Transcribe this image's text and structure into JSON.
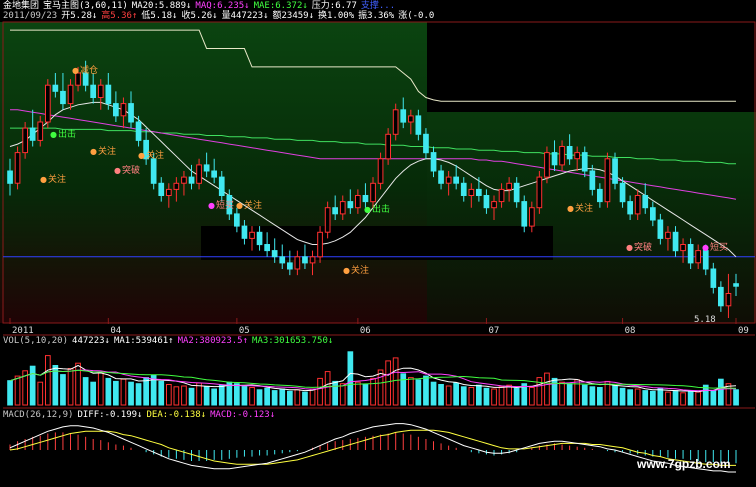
{
  "header": {
    "line1": [
      {
        "text": "金地集团",
        "color": "#ffffff"
      },
      {
        "text": "宝马主图(3,60,11)",
        "color": "#ffffff"
      },
      {
        "text": "MA20:5.889↓",
        "color": "#ffffff"
      },
      {
        "text": "MAQ:6.235↓",
        "color": "#ff40ff"
      },
      {
        "text": "MAE:6.372↓",
        "color": "#40ff40"
      },
      {
        "text": "压力:6.77",
        "color": "#ffffff"
      },
      {
        "text": "支撑...",
        "color": "#4060ff"
      }
    ],
    "line2": [
      {
        "text": "2011/09/23",
        "color": "#c8c8c8"
      },
      {
        "text": "开5.28↓",
        "color": "#ffffff"
      },
      {
        "text": "高5.36↑",
        "color": "#ff4040"
      },
      {
        "text": "低5.18↓",
        "color": "#ffffff"
      },
      {
        "text": "收5.26↓",
        "color": "#ffffff"
      },
      {
        "text": "量447223↓",
        "color": "#ffffff"
      },
      {
        "text": "额23459↓",
        "color": "#ffffff"
      },
      {
        "text": "换1.00%",
        "color": "#ffffff"
      },
      {
        "text": "振3.36%",
        "color": "#ffffff"
      },
      {
        "text": "涨(-0.0",
        "color": "#ffffff"
      }
    ]
  },
  "vol_header": [
    {
      "text": "VOL(5,10,20)",
      "color": "#c8c8c8"
    },
    {
      "text": "447223↓",
      "color": "#ffffff"
    },
    {
      "text": "MA1:539461↑",
      "color": "#ffffff"
    },
    {
      "text": "MA2:380923.5↑",
      "color": "#ff40ff"
    },
    {
      "text": "MA3:301653.750↓",
      "color": "#40ff40"
    }
  ],
  "macd_header": [
    {
      "text": "MACD(26,12,9)",
      "color": "#c8c8c8"
    },
    {
      "text": "DIFF:-0.199↓",
      "color": "#ffffff"
    },
    {
      "text": "DEA:-0.138↓",
      "color": "#ffff40"
    },
    {
      "text": "MACD:-0.123↓",
      "color": "#ff40ff"
    }
  ],
  "signals": [
    {
      "text": "减仓",
      "dot": "#ffa040",
      "color": "#ffa040"
    },
    {
      "text": "出击",
      "dot": "#40ff40",
      "color": "#40ff40"
    },
    {
      "text": "关注",
      "dot": "#ffa040",
      "color": "#ffa040"
    },
    {
      "text": "关注",
      "dot": "#ffa040",
      "color": "#ffa040"
    },
    {
      "text": "关注",
      "dot": "#ffa040",
      "color": "#ffa040"
    },
    {
      "text": "突破",
      "dot": "#ff8080",
      "color": "#ff8080"
    },
    {
      "text": "短买",
      "dot": "#ff40ff",
      "color": "#ff8080"
    },
    {
      "text": "关注",
      "dot": "#ffa040",
      "color": "#ffa040"
    },
    {
      "text": "出击",
      "dot": "#40ff40",
      "color": "#40ff40"
    },
    {
      "text": "关注",
      "dot": "#ffa040",
      "color": "#ffa040"
    },
    {
      "text": "关注",
      "dot": "#ffa040",
      "color": "#ffa040"
    },
    {
      "text": "突破",
      "dot": "#ff8080",
      "color": "#ff8080"
    },
    {
      "text": "短买",
      "dot": "#ff40ff",
      "color": "#ff8080"
    }
  ],
  "last_price_label": "5.18",
  "watermark": "www.7gpzb.com",
  "chart_data": {
    "type": "candlestick",
    "x_ticks": [
      "2011",
      "04",
      "05",
      "06",
      "07",
      "08",
      "09"
    ],
    "price_ylim": [
      5.0,
      7.4
    ],
    "candles": [
      [
        6.2,
        6.3,
        6.0,
        6.1
      ],
      [
        6.1,
        6.4,
        6.05,
        6.35
      ],
      [
        6.35,
        6.6,
        6.3,
        6.55
      ],
      [
        6.55,
        6.7,
        6.4,
        6.45
      ],
      [
        6.45,
        6.65,
        6.4,
        6.6
      ],
      [
        6.6,
        6.95,
        6.55,
        6.9
      ],
      [
        6.9,
        7.0,
        6.8,
        6.85
      ],
      [
        6.85,
        7.0,
        6.7,
        6.75
      ],
      [
        6.75,
        6.95,
        6.7,
        6.9
      ],
      [
        6.9,
        7.05,
        6.85,
        7.0
      ],
      [
        7.0,
        7.1,
        6.85,
        6.9
      ],
      [
        6.9,
        7.0,
        6.75,
        6.8
      ],
      [
        6.8,
        6.95,
        6.7,
        6.9
      ],
      [
        6.9,
        7.0,
        6.7,
        6.75
      ],
      [
        6.75,
        6.85,
        6.6,
        6.65
      ],
      [
        6.65,
        6.8,
        6.55,
        6.75
      ],
      [
        6.75,
        6.85,
        6.55,
        6.6
      ],
      [
        6.6,
        6.65,
        6.4,
        6.45
      ],
      [
        6.45,
        6.55,
        6.25,
        6.3
      ],
      [
        6.3,
        6.35,
        6.05,
        6.1
      ],
      [
        6.1,
        6.15,
        5.95,
        6.0
      ],
      [
        6.0,
        6.1,
        5.9,
        6.05
      ],
      [
        6.05,
        6.15,
        5.95,
        6.1
      ],
      [
        6.1,
        6.2,
        6.0,
        6.15
      ],
      [
        6.15,
        6.25,
        6.05,
        6.1
      ],
      [
        6.1,
        6.3,
        6.05,
        6.25
      ],
      [
        6.25,
        6.35,
        6.15,
        6.2
      ],
      [
        6.2,
        6.3,
        6.1,
        6.15
      ],
      [
        6.15,
        6.2,
        5.95,
        6.0
      ],
      [
        6.0,
        6.05,
        5.8,
        5.85
      ],
      [
        5.85,
        5.9,
        5.7,
        5.75
      ],
      [
        5.75,
        5.8,
        5.6,
        5.65
      ],
      [
        5.65,
        5.75,
        5.55,
        5.7
      ],
      [
        5.7,
        5.75,
        5.55,
        5.6
      ],
      [
        5.6,
        5.7,
        5.5,
        5.55
      ],
      [
        5.55,
        5.65,
        5.45,
        5.5
      ],
      [
        5.5,
        5.6,
        5.4,
        5.45
      ],
      [
        5.45,
        5.55,
        5.35,
        5.4
      ],
      [
        5.4,
        5.55,
        5.35,
        5.5
      ],
      [
        5.5,
        5.6,
        5.4,
        5.45
      ],
      [
        5.45,
        5.55,
        5.35,
        5.5
      ],
      [
        5.5,
        5.75,
        5.45,
        5.7
      ],
      [
        5.7,
        5.95,
        5.65,
        5.9
      ],
      [
        5.9,
        6.0,
        5.8,
        5.85
      ],
      [
        5.85,
        6.0,
        5.8,
        5.95
      ],
      [
        5.95,
        6.05,
        5.85,
        5.9
      ],
      [
        5.9,
        6.05,
        5.85,
        6.0
      ],
      [
        6.0,
        6.1,
        5.9,
        5.95
      ],
      [
        5.95,
        6.15,
        5.9,
        6.1
      ],
      [
        6.1,
        6.35,
        6.05,
        6.3
      ],
      [
        6.3,
        6.55,
        6.25,
        6.5
      ],
      [
        6.5,
        6.75,
        6.45,
        6.7
      ],
      [
        6.7,
        6.8,
        6.55,
        6.6
      ],
      [
        6.6,
        6.7,
        6.5,
        6.65
      ],
      [
        6.65,
        6.7,
        6.45,
        6.5
      ],
      [
        6.5,
        6.55,
        6.3,
        6.35
      ],
      [
        6.35,
        6.4,
        6.15,
        6.2
      ],
      [
        6.2,
        6.25,
        6.05,
        6.1
      ],
      [
        6.1,
        6.2,
        6.0,
        6.15
      ],
      [
        6.15,
        6.25,
        6.05,
        6.1
      ],
      [
        6.1,
        6.15,
        5.95,
        6.0
      ],
      [
        6.0,
        6.1,
        5.9,
        6.05
      ],
      [
        6.05,
        6.15,
        5.95,
        6.0
      ],
      [
        6.0,
        6.05,
        5.85,
        5.9
      ],
      [
        5.9,
        6.0,
        5.8,
        5.95
      ],
      [
        5.95,
        6.1,
        5.9,
        6.05
      ],
      [
        6.05,
        6.15,
        5.95,
        6.1
      ],
      [
        6.1,
        6.15,
        5.9,
        5.95
      ],
      [
        5.95,
        6.0,
        5.7,
        5.75
      ],
      [
        5.75,
        5.95,
        5.7,
        5.9
      ],
      [
        5.9,
        6.2,
        5.85,
        6.15
      ],
      [
        6.15,
        6.4,
        6.1,
        6.35
      ],
      [
        6.35,
        6.45,
        6.2,
        6.25
      ],
      [
        6.25,
        6.45,
        6.2,
        6.4
      ],
      [
        6.4,
        6.5,
        6.25,
        6.3
      ],
      [
        6.3,
        6.4,
        6.2,
        6.35
      ],
      [
        6.35,
        6.4,
        6.15,
        6.2
      ],
      [
        6.2,
        6.25,
        6.0,
        6.05
      ],
      [
        6.05,
        6.1,
        5.9,
        5.95
      ],
      [
        5.95,
        6.35,
        5.9,
        6.3
      ],
      [
        6.3,
        6.35,
        6.05,
        6.1
      ],
      [
        6.1,
        6.15,
        5.9,
        5.95
      ],
      [
        5.95,
        6.0,
        5.8,
        5.85
      ],
      [
        5.85,
        6.05,
        5.8,
        6.0
      ],
      [
        6.0,
        6.1,
        5.85,
        5.9
      ],
      [
        5.9,
        5.95,
        5.75,
        5.8
      ],
      [
        5.8,
        5.85,
        5.6,
        5.65
      ],
      [
        5.65,
        5.75,
        5.55,
        5.7
      ],
      [
        5.7,
        5.75,
        5.5,
        5.55
      ],
      [
        5.55,
        5.65,
        5.45,
        5.6
      ],
      [
        5.6,
        5.65,
        5.4,
        5.45
      ],
      [
        5.45,
        5.6,
        5.4,
        5.55
      ],
      [
        5.55,
        5.6,
        5.35,
        5.4
      ],
      [
        5.4,
        5.45,
        5.2,
        5.25
      ],
      [
        5.25,
        5.3,
        5.05,
        5.1
      ],
      [
        5.1,
        5.36,
        5.0,
        5.2
      ],
      [
        5.28,
        5.36,
        5.18,
        5.26
      ]
    ],
    "ma20": [
      6.4,
      6.42,
      6.45,
      6.5,
      6.55,
      6.6,
      6.66,
      6.7,
      6.72,
      6.74,
      6.75,
      6.76,
      6.76,
      6.74,
      6.72,
      6.7,
      6.66,
      6.62,
      6.56,
      6.5,
      6.44,
      6.38,
      6.32,
      6.26,
      6.2,
      6.16,
      6.12,
      6.08,
      6.04,
      6.0,
      5.96,
      5.92,
      5.88,
      5.84,
      5.8,
      5.76,
      5.72,
      5.68,
      5.64,
      5.62,
      5.6,
      5.6,
      5.61,
      5.63,
      5.66,
      5.7,
      5.76,
      5.82,
      5.9,
      5.98,
      6.06,
      6.14,
      6.2,
      6.25,
      6.28,
      6.3,
      6.3,
      6.29,
      6.27,
      6.24,
      6.2,
      6.16,
      6.12,
      6.08,
      6.05,
      6.04,
      6.04,
      6.06,
      6.08,
      6.1,
      6.12,
      6.14,
      6.16,
      6.18,
      6.2,
      6.21,
      6.22,
      6.22,
      6.21,
      6.19,
      6.16,
      6.12,
      6.08,
      6.04,
      6.0,
      5.96,
      5.92,
      5.88,
      5.84,
      5.8,
      5.76,
      5.72,
      5.68,
      5.64,
      5.6,
      5.56,
      5.5
    ],
    "ma60": [
      6.7,
      6.7,
      6.69,
      6.68,
      6.67,
      6.66,
      6.65,
      6.64,
      6.63,
      6.62,
      6.61,
      6.6,
      6.59,
      6.58,
      6.57,
      6.56,
      6.55,
      6.54,
      6.53,
      6.52,
      6.51,
      6.5,
      6.49,
      6.48,
      6.47,
      6.46,
      6.45,
      6.44,
      6.43,
      6.42,
      6.41,
      6.4,
      6.39,
      6.38,
      6.37,
      6.36,
      6.35,
      6.34,
      6.33,
      6.32,
      6.31,
      6.3,
      6.3,
      6.3,
      6.3,
      6.3,
      6.3,
      6.3,
      6.3,
      6.3,
      6.3,
      6.3,
      6.3,
      6.3,
      6.3,
      6.3,
      6.3,
      6.3,
      6.3,
      6.3,
      6.3,
      6.3,
      6.29,
      6.29,
      6.28,
      6.28,
      6.27,
      6.26,
      6.25,
      6.24,
      6.23,
      6.22,
      6.21,
      6.2,
      6.19,
      6.18,
      6.17,
      6.16,
      6.15,
      6.14,
      6.13,
      6.12,
      6.11,
      6.1,
      6.09,
      6.08,
      6.07,
      6.06,
      6.05,
      6.04,
      6.03,
      6.02,
      6.01,
      6.0,
      5.99,
      5.98,
      5.97
    ],
    "ma120": [
      6.55,
      6.55,
      6.55,
      6.55,
      6.55,
      6.55,
      6.55,
      6.54,
      6.54,
      6.54,
      6.54,
      6.54,
      6.54,
      6.53,
      6.53,
      6.53,
      6.53,
      6.52,
      6.52,
      6.52,
      6.51,
      6.51,
      6.51,
      6.5,
      6.5,
      6.5,
      6.49,
      6.49,
      6.49,
      6.48,
      6.48,
      6.48,
      6.47,
      6.47,
      6.47,
      6.46,
      6.46,
      6.46,
      6.45,
      6.45,
      6.45,
      6.44,
      6.44,
      6.44,
      6.43,
      6.43,
      6.43,
      6.42,
      6.42,
      6.42,
      6.41,
      6.41,
      6.41,
      6.4,
      6.4,
      6.4,
      6.39,
      6.39,
      6.39,
      6.38,
      6.38,
      6.38,
      6.37,
      6.37,
      6.37,
      6.36,
      6.36,
      6.36,
      6.35,
      6.35,
      6.35,
      6.34,
      6.34,
      6.34,
      6.33,
      6.33,
      6.33,
      6.32,
      6.32,
      6.32,
      6.31,
      6.31,
      6.31,
      6.3,
      6.3,
      6.3,
      6.29,
      6.29,
      6.29,
      6.28,
      6.28,
      6.28,
      6.27,
      6.27,
      6.27,
      6.26,
      6.26
    ],
    "pressure_line": [
      7.35,
      7.35,
      7.35,
      7.35,
      7.35,
      7.35,
      7.35,
      7.35,
      7.35,
      7.35,
      7.35,
      7.35,
      7.35,
      7.35,
      7.35,
      7.35,
      7.35,
      7.35,
      7.35,
      7.35,
      7.35,
      7.35,
      7.35,
      7.35,
      7.35,
      7.35,
      7.2,
      7.2,
      7.2,
      7.2,
      7.2,
      7.2,
      7.05,
      7.05,
      7.05,
      7.05,
      7.05,
      7.05,
      7.05,
      7.05,
      7.05,
      7.05,
      7.05,
      7.05,
      7.05,
      7.05,
      7.05,
      7.05,
      7.05,
      7.05,
      7.05,
      7.05,
      7.0,
      6.95,
      6.85,
      6.8,
      6.78,
      6.77,
      6.77,
      6.77,
      6.77,
      6.77,
      6.77,
      6.77,
      6.77,
      6.77,
      6.77,
      6.77,
      6.77,
      6.77,
      6.77,
      6.77,
      6.77,
      6.77,
      6.77,
      6.77,
      6.77,
      6.77,
      6.77,
      6.77,
      6.77,
      6.77,
      6.77,
      6.77,
      6.77,
      6.77,
      6.77,
      6.77,
      6.77,
      6.77,
      6.77,
      6.77,
      6.77,
      6.77,
      6.77,
      6.77,
      6.77
    ],
    "support_level": 5.5,
    "volume": [
      3.2,
      3.8,
      4.5,
      5.1,
      3.0,
      6.5,
      5.2,
      4.0,
      4.8,
      5.5,
      3.6,
      3.0,
      4.2,
      3.5,
      3.1,
      3.4,
      3.0,
      2.8,
      3.6,
      3.9,
      3.1,
      2.7,
      2.4,
      2.5,
      2.2,
      2.9,
      2.4,
      2.1,
      2.6,
      3.0,
      2.8,
      2.5,
      2.3,
      2.0,
      2.2,
      1.9,
      2.1,
      1.8,
      2.0,
      1.7,
      2.1,
      3.5,
      4.4,
      3.1,
      2.8,
      7.0,
      3.0,
      2.7,
      3.5,
      4.6,
      5.8,
      6.2,
      4.1,
      3.6,
      3.3,
      3.8,
      3.0,
      2.7,
      2.5,
      2.9,
      2.4,
      2.3,
      2.6,
      2.2,
      2.1,
      2.4,
      2.6,
      2.2,
      2.8,
      2.3,
      3.6,
      4.2,
      3.5,
      3.0,
      2.8,
      3.3,
      2.6,
      2.4,
      2.3,
      3.1,
      2.5,
      2.2,
      2.0,
      2.1,
      1.9,
      1.8,
      2.2,
      1.7,
      1.9,
      1.6,
      1.8,
      1.7,
      2.6,
      1.9,
      3.4,
      2.8,
      2.0
    ],
    "macd_hist": [
      0.05,
      0.08,
      0.1,
      0.12,
      0.13,
      0.15,
      0.16,
      0.16,
      0.15,
      0.14,
      0.12,
      0.1,
      0.09,
      0.07,
      0.05,
      0.04,
      0.02,
      0.0,
      -0.02,
      -0.04,
      -0.06,
      -0.07,
      -0.08,
      -0.09,
      -0.1,
      -0.1,
      -0.1,
      -0.09,
      -0.09,
      -0.08,
      -0.07,
      -0.06,
      -0.06,
      -0.05,
      -0.05,
      -0.04,
      -0.03,
      -0.02,
      -0.01,
      0.0,
      0.02,
      0.04,
      0.06,
      0.08,
      0.09,
      0.1,
      0.11,
      0.12,
      0.13,
      0.14,
      0.15,
      0.16,
      0.15,
      0.14,
      0.12,
      0.1,
      0.08,
      0.06,
      0.04,
      0.02,
      0.0,
      -0.02,
      -0.03,
      -0.04,
      -0.05,
      -0.04,
      -0.03,
      -0.02,
      0.0,
      0.02,
      0.04,
      0.05,
      0.06,
      0.05,
      0.04,
      0.03,
      0.02,
      0.01,
      0.0,
      -0.01,
      -0.02,
      -0.02,
      -0.03,
      -0.04,
      -0.05,
      -0.06,
      -0.06,
      -0.07,
      -0.08,
      -0.08,
      -0.09,
      -0.1,
      -0.11,
      -0.11,
      -0.12,
      -0.12,
      -0.12
    ],
    "diff": [
      0.02,
      0.05,
      0.08,
      0.11,
      0.14,
      0.17,
      0.19,
      0.21,
      0.22,
      0.22,
      0.21,
      0.2,
      0.18,
      0.16,
      0.13,
      0.1,
      0.07,
      0.04,
      0.01,
      -0.02,
      -0.05,
      -0.08,
      -0.1,
      -0.12,
      -0.14,
      -0.15,
      -0.16,
      -0.17,
      -0.17,
      -0.17,
      -0.16,
      -0.15,
      -0.14,
      -0.13,
      -0.12,
      -0.1,
      -0.08,
      -0.06,
      -0.04,
      -0.02,
      0.01,
      0.04,
      0.07,
      0.1,
      0.12,
      0.15,
      0.17,
      0.19,
      0.21,
      0.22,
      0.23,
      0.24,
      0.24,
      0.23,
      0.21,
      0.19,
      0.16,
      0.13,
      0.1,
      0.07,
      0.04,
      0.02,
      0.0,
      -0.02,
      -0.03,
      -0.03,
      -0.02,
      0.0,
      0.02,
      0.04,
      0.06,
      0.07,
      0.08,
      0.08,
      0.07,
      0.06,
      0.05,
      0.04,
      0.03,
      0.01,
      0.0,
      -0.02,
      -0.04,
      -0.06,
      -0.08,
      -0.1,
      -0.11,
      -0.12,
      -0.14,
      -0.15,
      -0.16,
      -0.17,
      -0.18,
      -0.19,
      -0.19,
      -0.2,
      -0.2
    ],
    "dea": [
      0.0,
      0.01,
      0.03,
      0.05,
      0.07,
      0.09,
      0.11,
      0.13,
      0.15,
      0.16,
      0.17,
      0.17,
      0.17,
      0.17,
      0.16,
      0.14,
      0.13,
      0.11,
      0.09,
      0.07,
      0.05,
      0.02,
      0.0,
      -0.02,
      -0.04,
      -0.06,
      -0.08,
      -0.1,
      -0.11,
      -0.12,
      -0.13,
      -0.13,
      -0.13,
      -0.13,
      -0.13,
      -0.12,
      -0.11,
      -0.1,
      -0.09,
      -0.07,
      -0.05,
      -0.03,
      -0.01,
      0.01,
      0.03,
      0.05,
      0.07,
      0.09,
      0.11,
      0.13,
      0.14,
      0.16,
      0.17,
      0.18,
      0.18,
      0.18,
      0.18,
      0.17,
      0.16,
      0.14,
      0.12,
      0.1,
      0.08,
      0.06,
      0.04,
      0.02,
      0.01,
      0.01,
      0.01,
      0.02,
      0.03,
      0.04,
      0.05,
      0.06,
      0.06,
      0.06,
      0.06,
      0.05,
      0.05,
      0.04,
      0.03,
      0.02,
      0.0,
      -0.02,
      -0.03,
      -0.05,
      -0.06,
      -0.08,
      -0.09,
      -0.1,
      -0.11,
      -0.12,
      -0.13,
      -0.13,
      -0.14,
      -0.14,
      -0.14
    ]
  }
}
